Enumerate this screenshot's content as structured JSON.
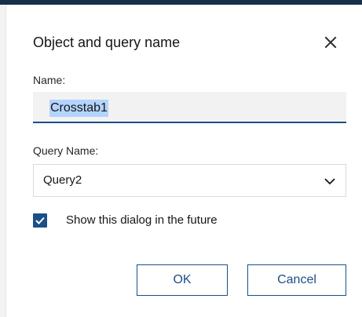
{
  "dialog": {
    "title": "Object and query name",
    "close_icon": "close-icon"
  },
  "name_field": {
    "label": "Name:",
    "value": "Crosstab1",
    "selected": true
  },
  "query_field": {
    "label": "Query Name:",
    "selected_value": "Query2",
    "chevron_icon": "chevron-down-icon"
  },
  "show_dialog_checkbox": {
    "label": "Show this dialog in the future",
    "checked": true
  },
  "buttons": {
    "ok_label": "OK",
    "cancel_label": "Cancel"
  },
  "colors": {
    "accent": "#1b4f87",
    "top_bar": "#162f4a",
    "selection": "#b3d4fc"
  }
}
